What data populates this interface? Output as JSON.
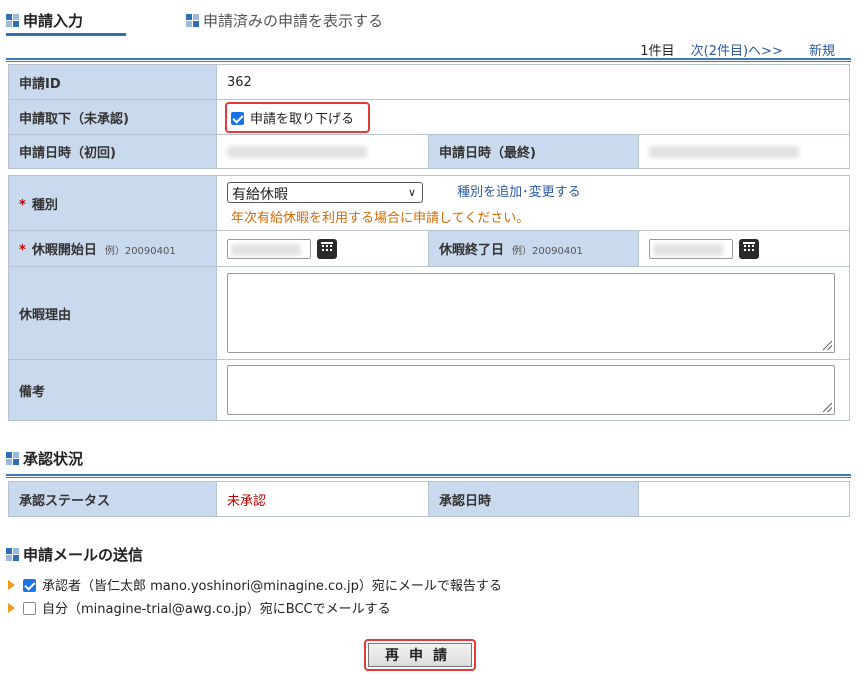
{
  "tabs": {
    "active": "申請入力",
    "inactive": "申請済みの申請を表示する"
  },
  "pager": {
    "current": "1件目",
    "next": "次(2件目)へ>>",
    "new": "新規"
  },
  "application": {
    "id_label": "申請ID",
    "id_value": "362",
    "withdraw_label": "申請取下（未承認)",
    "withdraw_checkbox_label": "申請を取り下げる",
    "withdraw_checked": true,
    "first_datetime_label": "申請日時（初回)",
    "last_datetime_label": "申請日時（最終)"
  },
  "form": {
    "type_label": "種別",
    "type_value": "有給休暇",
    "type_edit_link": "種別を追加･変更する",
    "type_notice": "年次有給休暇を利用する場合に申請してください。",
    "start_label": "休暇開始日",
    "start_hint": "例）20090401",
    "end_label": "休暇終了日",
    "end_hint": "例）20090401",
    "reason_label": "休暇理由",
    "notes_label": "備考",
    "required_mark": "*"
  },
  "approval": {
    "section_title": "承認状況",
    "status_label": "承認ステータス",
    "status_value": "未承認",
    "date_label": "承認日時",
    "status_color": "#c00000"
  },
  "mail": {
    "section_title": "申請メールの送信",
    "approver_text": "承認者（皆仁太郎 mano.yoshinori@minagine.co.jp）宛にメールで報告する",
    "approver_checked": true,
    "self_text": "自分（minagine-trial@awg.co.jp）宛にBCCでメールする",
    "self_checked": false
  },
  "actions": {
    "resubmit_label": "再申請"
  },
  "colors": {
    "label_bg": "#c9d9ee",
    "accent": "#2f6fb5",
    "highlight": "#e23a3a",
    "notice": "#d26a00"
  }
}
